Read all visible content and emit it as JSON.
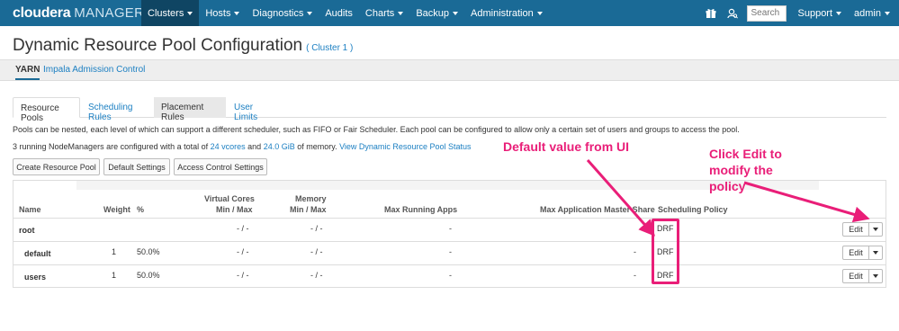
{
  "nav": {
    "brand_main": "cloudera",
    "brand_sub": "MANAGER",
    "items": [
      {
        "label": "Clusters",
        "dropdown": true,
        "active": true
      },
      {
        "label": "Hosts",
        "dropdown": true
      },
      {
        "label": "Diagnostics",
        "dropdown": true
      },
      {
        "label": "Audits",
        "dropdown": false
      },
      {
        "label": "Charts",
        "dropdown": true
      },
      {
        "label": "Backup",
        "dropdown": true
      },
      {
        "label": "Administration",
        "dropdown": true
      }
    ],
    "search_placeholder": "Search",
    "support": "Support",
    "user": "admin",
    "icons": [
      "gift-icon",
      "user-search-icon"
    ],
    "bg_color": "#1a6a96"
  },
  "page": {
    "title": "Dynamic Resource Pool Configuration",
    "cluster": "( Cluster 1 )"
  },
  "subnav": {
    "yarn": "YARN",
    "impala": "Impala Admission Control"
  },
  "tabs": [
    "Resource Pools",
    "Scheduling Rules",
    "Placement Rules",
    "User Limits"
  ],
  "description": {
    "line1": "Pools can be nested, each level of which can support a different scheduler, such as FIFO or Fair Scheduler. Each pool can be configured to allow only a certain set of users and groups to access the pool.",
    "line2_prefix": "3 running NodeManagers are configured with a total of ",
    "vcores": "24 vcores",
    "and": " and ",
    "memory": "24.0 GiB",
    "line2_suffix": " of memory. ",
    "status_link": "View Dynamic Resource Pool Status"
  },
  "buttons": {
    "create": "Create Resource Pool",
    "default_settings": "Default Settings",
    "access_control": "Access Control Settings"
  },
  "table": {
    "headers": {
      "name": "Name",
      "weight": "Weight",
      "pct": "%",
      "vcores_1": "Virtual Cores",
      "vcores_2": "Min / Max",
      "memory_1": "Memory",
      "memory_2": "Min / Max",
      "max_apps": "Max Running Apps",
      "max_am": "Max Application Master Share",
      "policy": "Scheduling Policy"
    },
    "rows": [
      {
        "name": "root",
        "weight": "",
        "pct": "",
        "vcores": "- / -",
        "memory": "- / -",
        "max_apps": "-",
        "max_am": "-",
        "policy": "DRF",
        "edit": "Edit"
      },
      {
        "name": "default",
        "weight": "1",
        "pct": "50.0%",
        "vcores": "- / -",
        "memory": "- / -",
        "max_apps": "-",
        "max_am": "-",
        "policy": "DRF",
        "edit": "Edit"
      },
      {
        "name": "users",
        "weight": "1",
        "pct": "50.0%",
        "vcores": "- / -",
        "memory": "- / -",
        "max_apps": "-",
        "max_am": "-",
        "policy": "DRF",
        "edit": "Edit"
      }
    ]
  },
  "annotations": {
    "default_value": "Default value from UI",
    "click_edit_1": "Click Edit to",
    "click_edit_2": "modify the",
    "click_edit_3": "policy",
    "color": "#e91e78"
  }
}
